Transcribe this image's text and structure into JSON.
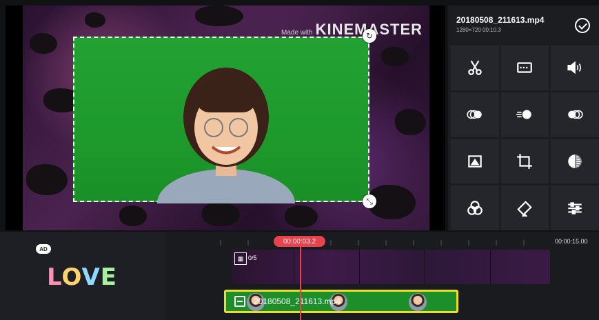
{
  "preview": {
    "watermark_small": "Made with",
    "watermark_brand": "KINEMASTER"
  },
  "file": {
    "name": "20180508_211613.mp4",
    "meta": "1280×720  00:10.3"
  },
  "tools": [
    {
      "name": "scissors-icon"
    },
    {
      "name": "split-screen-icon"
    },
    {
      "name": "volume-icon"
    },
    {
      "name": "in-animation-icon"
    },
    {
      "name": "overall-animation-icon"
    },
    {
      "name": "out-animation-icon"
    },
    {
      "name": "pan-zoom-icon"
    },
    {
      "name": "crop-icon"
    },
    {
      "name": "chroma-key-icon"
    },
    {
      "name": "color-filter-icon"
    },
    {
      "name": "rotate-mirror-icon"
    },
    {
      "name": "adjustment-icon"
    }
  ],
  "timeline": {
    "ad_badge": "AD",
    "asset_word": [
      "L",
      "O",
      "V",
      "E"
    ],
    "current_time": "00:00:03.2",
    "end_time": "00:00:15.00",
    "top_track_label": "0/5",
    "clip_name": "20180508_211613.mp4"
  },
  "colors": {
    "accent": "#e8424c",
    "selection": "#f2dc2b",
    "green_screen": "#1e9a2c"
  }
}
